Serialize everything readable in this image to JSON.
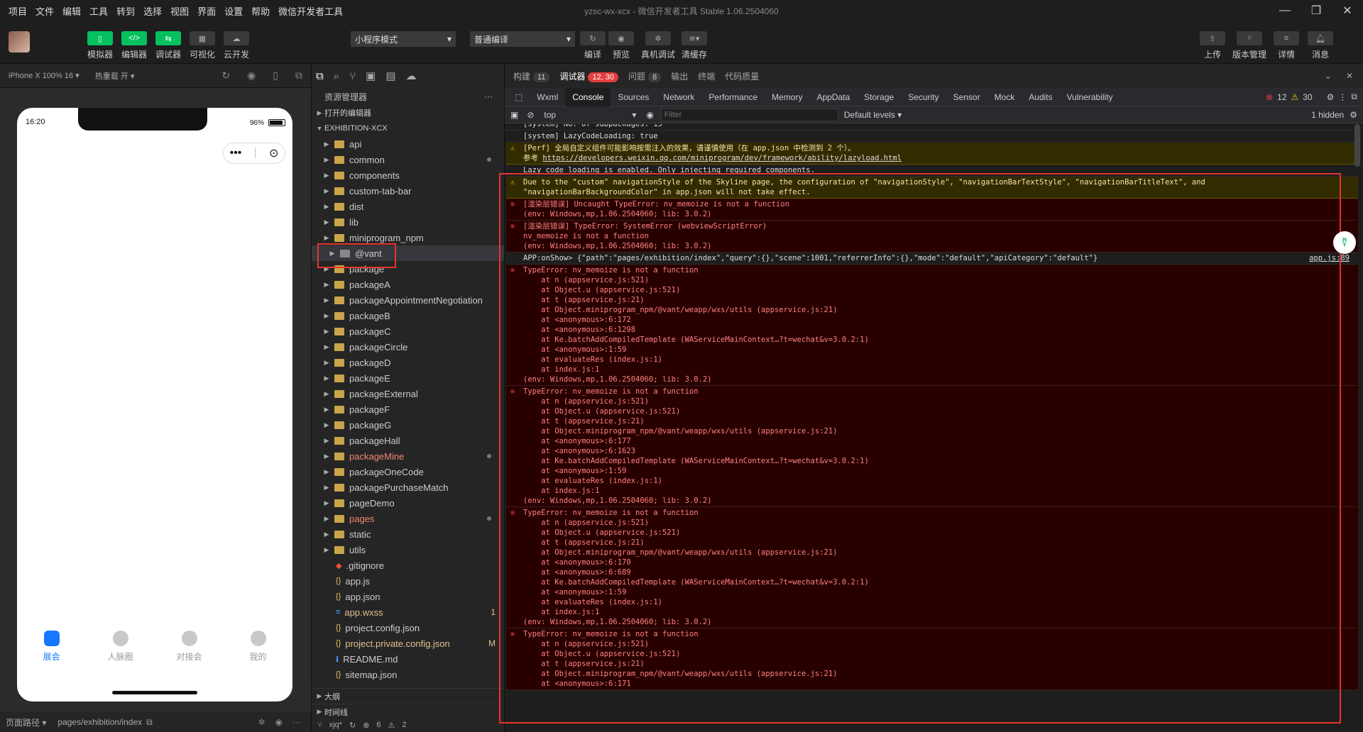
{
  "menu": [
    "项目",
    "文件",
    "编辑",
    "工具",
    "转到",
    "选择",
    "视图",
    "界面",
    "设置",
    "帮助",
    "微信开发者工具"
  ],
  "window_title": "yzsc-wx-xcx - 微信开发者工具 Stable 1.06.2504060",
  "toolbar": {
    "simulator": "模拟器",
    "editor": "编辑器",
    "debugger": "调试器",
    "visual": "可视化",
    "cloud": "云开发",
    "mode_select": "小程序模式",
    "compile_select": "普通编译",
    "compile": "编译",
    "preview": "预览",
    "remote_debug": "真机调试",
    "clear_cache": "清缓存",
    "upload": "上传",
    "version": "版本管理",
    "detail": "详情",
    "message": "消息"
  },
  "simbar": {
    "device": "iPhone X 100% 16 ▾",
    "hotreload": "热重载 开 ▾"
  },
  "phone": {
    "time": "16:20",
    "battery": "96%",
    "tabs": [
      "展会",
      "人脉圈",
      "对接会",
      "我的"
    ]
  },
  "statusbar": {
    "path_label": "页面路径 ▾",
    "path": "pages/exhibition/index",
    "branch": "xjq*",
    "errors": "6",
    "warnings": "2"
  },
  "explorer": {
    "title": "资源管理器",
    "open_editors": "打开的编辑器",
    "project": "EXHIBITION-XCX",
    "items": [
      {
        "name": "api",
        "type": "folder"
      },
      {
        "name": "common",
        "type": "folder",
        "dot": true
      },
      {
        "name": "components",
        "type": "folder"
      },
      {
        "name": "custom-tab-bar",
        "type": "folder"
      },
      {
        "name": "dist",
        "type": "folder"
      },
      {
        "name": "lib",
        "type": "folder"
      },
      {
        "name": "miniprogram_npm",
        "type": "folder"
      },
      {
        "name": "@vant",
        "type": "folder",
        "sub": true
      },
      {
        "name": "package",
        "type": "folder"
      },
      {
        "name": "packageA",
        "type": "folder"
      },
      {
        "name": "packageAppointmentNegotiation",
        "type": "folder"
      },
      {
        "name": "packageB",
        "type": "folder"
      },
      {
        "name": "packageC",
        "type": "folder"
      },
      {
        "name": "packageCircle",
        "type": "folder"
      },
      {
        "name": "packageD",
        "type": "folder"
      },
      {
        "name": "packageE",
        "type": "folder"
      },
      {
        "name": "packageExternal",
        "type": "folder"
      },
      {
        "name": "packageF",
        "type": "folder"
      },
      {
        "name": "packageG",
        "type": "folder"
      },
      {
        "name": "packageHall",
        "type": "folder"
      },
      {
        "name": "packageMine",
        "type": "folder",
        "dot": true,
        "color": "orange"
      },
      {
        "name": "packageOneCode",
        "type": "folder"
      },
      {
        "name": "packagePurchaseMatch",
        "type": "folder"
      },
      {
        "name": "pageDemo",
        "type": "folder"
      },
      {
        "name": "pages",
        "type": "folder",
        "dot": true,
        "color": "orange"
      },
      {
        "name": "static",
        "type": "folder"
      },
      {
        "name": "utils",
        "type": "folder"
      },
      {
        "name": ".gitignore",
        "type": "file",
        "icon": "◆"
      },
      {
        "name": "app.js",
        "type": "file",
        "icon": "{}"
      },
      {
        "name": "app.json",
        "type": "file",
        "icon": "{}"
      },
      {
        "name": "app.wxss",
        "type": "file",
        "icon": "≡",
        "color": "yellow",
        "mark": "1"
      },
      {
        "name": "project.config.json",
        "type": "file",
        "icon": "{}"
      },
      {
        "name": "project.private.config.json",
        "type": "file",
        "icon": "{}",
        "color": "yellow",
        "mark": "M"
      },
      {
        "name": "README.md",
        "type": "file",
        "icon": "ℹ"
      },
      {
        "name": "sitemap.json",
        "type": "file",
        "icon": "{}"
      }
    ],
    "outline": "大纲",
    "timeline": "时间线"
  },
  "devtop": {
    "build": "构建",
    "build_count": "11",
    "debug": "调试器",
    "debug_count": "12, 30",
    "issues": "问题",
    "issues_count": "8",
    "output": "输出",
    "terminal": "终端",
    "quality": "代码质量"
  },
  "devtabs": [
    "Wxml",
    "Console",
    "Sources",
    "Network",
    "Performance",
    "Memory",
    "AppData",
    "Storage",
    "Security",
    "Sensor",
    "Mock",
    "Audits",
    "Vulnerability"
  ],
  "devcounts": {
    "errors": "12",
    "warnings": "30"
  },
  "filterbar": {
    "context": "top",
    "filter_placeholder": "Filter",
    "levels": "Default levels ▾",
    "hidden": "1 hidden"
  },
  "console": [
    {
      "type": "sys",
      "text": "[system] No. of subpackages: 15"
    },
    {
      "type": "sys",
      "text": "[system] LazyCodeLoading: true"
    },
    {
      "type": "warn",
      "text": "[Perf] 全局自定义组件可能影响按需注入的效果，请谨慎使用（在 app.json 中检测到 2 个）。\n参考 ",
      "link": "https://developers.weixin.qq.com/miniprogram/dev/framework/ability/lazyload.html"
    },
    {
      "type": "sys",
      "text": "Lazy code loading is enabled. Only injecting required components."
    },
    {
      "type": "warn",
      "text": "Due to the \"custom\" navigationStyle of the Skyline page, the configuration of \"navigationStyle\", \"navigationBarTextStyle\", \"navigationBarTitleText\", and\n\"navigationBarBackgroundColor\" in app.json will not take effect."
    },
    {
      "type": "err",
      "text": "[渲染层错误] Uncaught TypeError: nv_memoize is not a function\n(env: Windows,mp,1.06.2504060; lib: 3.0.2)"
    },
    {
      "type": "err",
      "text": "[渲染层错误] TypeError: SystemError (webviewScriptError)\nnv_memoize is not a function\n(env: Windows,mp,1.06.2504060; lib: 3.0.2)"
    },
    {
      "type": "log",
      "text": "APP:onShow> {\"path\":\"pages/exhibition/index\",\"query\":{},\"scene\":1001,\"referrerInfo\":{},\"mode\":\"default\",\"apiCategory\":\"default\"}",
      "src": "app.js:89"
    },
    {
      "type": "err",
      "text": "TypeError: nv_memoize is not a function\n    at n (appservice.js:521)\n    at Object.u (appservice.js:521)\n    at t (appservice.js:21)\n    at Object.miniprogram_npm/@vant/weapp/wxs/utils (appservice.js:21)\n    at <anonymous>:6:172\n    at <anonymous>:6:1298\n    at Ke.batchAddCompiledTemplate (WAServiceMainContext…?t=wechat&v=3.0.2:1)\n    at <anonymous>:1:59\n    at evaluateRes (index.js:1)\n    at index.js:1\n(env: Windows,mp,1.06.2504060; lib: 3.0.2)"
    },
    {
      "type": "err",
      "text": "TypeError: nv_memoize is not a function\n    at n (appservice.js:521)\n    at Object.u (appservice.js:521)\n    at t (appservice.js:21)\n    at Object.miniprogram_npm/@vant/weapp/wxs/utils (appservice.js:21)\n    at <anonymous>:6:177\n    at <anonymous>:6:1623\n    at Ke.batchAddCompiledTemplate (WAServiceMainContext…?t=wechat&v=3.0.2:1)\n    at <anonymous>:1:59\n    at evaluateRes (index.js:1)\n    at index.js:1\n(env: Windows,mp,1.06.2504060; lib: 3.0.2)"
    },
    {
      "type": "err",
      "text": "TypeError: nv_memoize is not a function\n    at n (appservice.js:521)\n    at Object.u (appservice.js:521)\n    at t (appservice.js:21)\n    at Object.miniprogram_npm/@vant/weapp/wxs/utils (appservice.js:21)\n    at <anonymous>:6:170\n    at <anonymous>:6:689\n    at Ke.batchAddCompiledTemplate (WAServiceMainContext…?t=wechat&v=3.0.2:1)\n    at <anonymous>:1:59\n    at evaluateRes (index.js:1)\n    at index.js:1\n(env: Windows,mp,1.06.2504060; lib: 3.0.2)"
    },
    {
      "type": "err",
      "text": "TypeError: nv_memoize is not a function\n    at n (appservice.js:521)\n    at Object.u (appservice.js:521)\n    at t (appservice.js:21)\n    at Object.miniprogram_npm/@vant/weapp/wxs/utils (appservice.js:21)\n    at <anonymous>:6:171"
    }
  ]
}
